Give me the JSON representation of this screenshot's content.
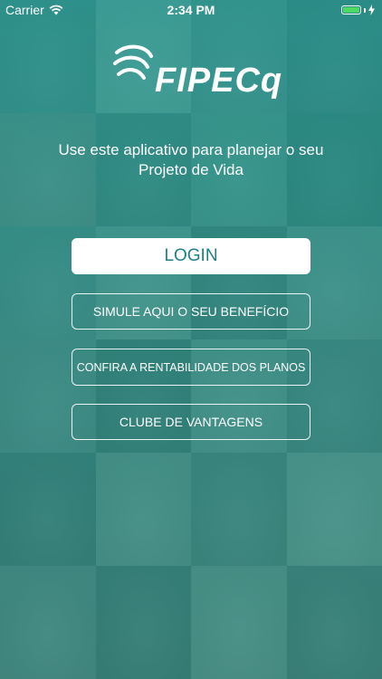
{
  "status": {
    "carrier": "Carrier",
    "time": "2:34 PM"
  },
  "brand": {
    "logo_text": "FIPECq"
  },
  "tagline": {
    "line1": "Use este aplicativo para planejar o seu",
    "line2": "Projeto de Vida"
  },
  "buttons": {
    "login": "LOGIN",
    "simulate": "SIMULE AQUI O SEU BENEFÍCIO",
    "profitability": "CONFIRA A RENTABILIDADE DOS PLANOS",
    "club": "CLUBE DE VANTAGENS"
  },
  "colors": {
    "overlay": "#2a8f8a",
    "login_text": "#1f7f86",
    "battery": "#4cd964"
  },
  "background_tiles": [
    "#6b7f76",
    "#a9b6a5",
    "#7f8e84",
    "#5d6f68",
    "#8e8a77",
    "#5e7468",
    "#7b9a86",
    "#4f6d60",
    "#6f8a7c",
    "#93a491",
    "#5b6e62",
    "#879a8a",
    "#7a8c80",
    "#526a5c",
    "#8a9e8e",
    "#6a7d72",
    "#5a6f64",
    "#8b9c8c",
    "#6c8073",
    "#9aa896",
    "#7c8e82",
    "#5f7468",
    "#8fa190",
    "#66796d"
  ]
}
